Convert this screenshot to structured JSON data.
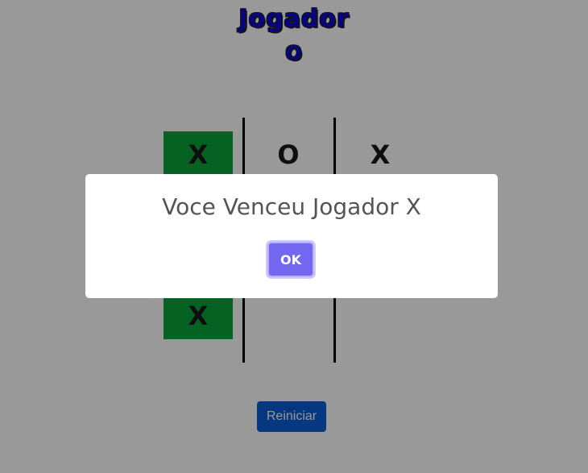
{
  "header": {
    "line1": "Jogador",
    "line2": "O"
  },
  "board": {
    "cells": [
      "X",
      "O",
      "X",
      "",
      "",
      "",
      "X",
      "",
      ""
    ],
    "winning_cells": [
      0,
      3,
      6
    ]
  },
  "restart_label": "Reiniciar",
  "modal": {
    "message": "Voce Venceu Jogador X",
    "ok_label": "OK"
  },
  "colors": {
    "title": "#0d0ad6",
    "win_cell": "#0aa33a",
    "restart_button": "#0b5ed7",
    "ok_button": "#7367f0"
  }
}
